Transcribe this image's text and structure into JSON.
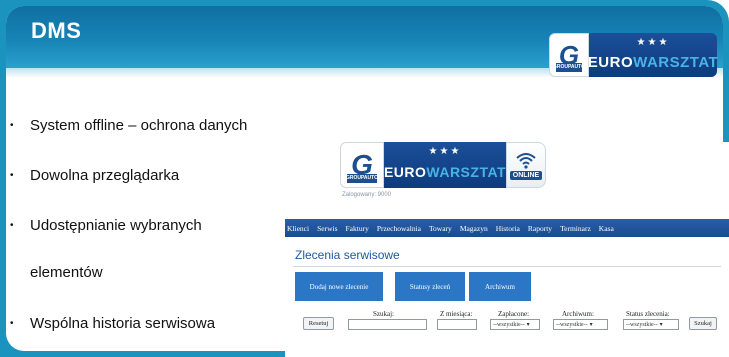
{
  "slide": {
    "title": "DMS",
    "colors": {
      "frame": "#1a93bf",
      "header": "#1784b5",
      "logo_navy": "#1b4f8f",
      "app_nav": "#1a4b8f",
      "app_button": "#2c76c6"
    }
  },
  "logo": {
    "g_letter": "G",
    "g_caption": "GROUPAUTO",
    "word_main": "EURO",
    "word_accent": "WARSZTAT",
    "stars": "★★★"
  },
  "bullets": [
    {
      "text": "System offline – ochrona danych",
      "marker": "•"
    },
    {
      "text": "Dowolna przeglądarka",
      "marker": "•"
    },
    {
      "text": "Udostępnianie wybranych",
      "marker": "•"
    },
    {
      "text": "elementów",
      "marker": ""
    },
    {
      "text": "Wspólna historia serwisowa",
      "marker": "•"
    }
  ],
  "app": {
    "online_badge": "ONLINE",
    "online_icon": "wifi-icon",
    "logged_text": "Zalogowany: 9000",
    "nav": [
      "Klienci",
      "Serwis",
      "Faktury",
      "Przechowalnia",
      "Towary",
      "Magazyn",
      "Historia",
      "Raporty",
      "Terminarz",
      "Kasa"
    ],
    "heading": "Zlecenia serwisowe",
    "buttons": [
      "Dodaj nowe zlecenie",
      "Statusy zleceń",
      "Archiwum"
    ],
    "filters": {
      "reset": "Resetuj",
      "search_label": "Szukaj:",
      "month_label": "Z miesiąca:",
      "paid_label": "Zapłacone:",
      "paid_value": "--wszystkie--",
      "archive_label": "Archiwum:",
      "archive_value": "--wszystkie--",
      "status_label": "Status zlecenia:",
      "status_value": "--wszystkie--",
      "search_button": "Szukaj"
    }
  }
}
